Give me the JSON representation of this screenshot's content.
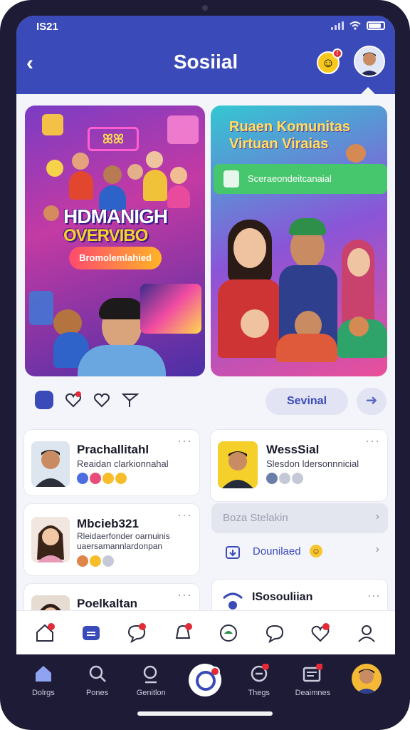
{
  "status_bar": {
    "time": "IS21"
  },
  "header": {
    "title": "Sosiial",
    "smiley_badge": "!"
  },
  "banners": {
    "left": {
      "title_line1": "HDMANIGH",
      "title_line2": "OVERVIBO",
      "cta": "Bromolemlahied"
    },
    "right": {
      "title_line1": "Ruaen Komunitas",
      "title_line2": "Virtuan Viraias",
      "bar_text": "Sceraeondeitcanaial"
    }
  },
  "actions": {
    "primary_button": "Sevinal",
    "arrow": "➜"
  },
  "cards": [
    {
      "name": "Prachallitahl",
      "subtitle": "Reaidan clarkionnahal"
    },
    {
      "name": "WessSial",
      "subtitle": "Slesdon ldersonnnicial"
    },
    {
      "name": "Mbcieb321",
      "subtitle_line1": "Rleidaerfonder oarnuinis",
      "subtitle_line2": "uaersamannlardonpan"
    },
    {
      "name": "Poelkaltan",
      "subtitle": ""
    }
  ],
  "list_rows": [
    {
      "label": "Boza Stelakin"
    },
    {
      "label": "Dounilaed"
    },
    {
      "label": "ISosouliian"
    }
  ],
  "bottom_nav": [
    {
      "label": "Dolrgs"
    },
    {
      "label": "Pones"
    },
    {
      "label": "Genitlon"
    },
    {
      "label": ""
    },
    {
      "label": "Thegs"
    },
    {
      "label": "Deaimnes"
    },
    {
      "label": ""
    }
  ],
  "colors": {
    "brand": "#3a4ab8",
    "notification": "#e32a37",
    "cta_gradient_start": "#ff4a6e",
    "cta_gradient_end": "#ffb326",
    "green_bar": "#46c76d"
  }
}
